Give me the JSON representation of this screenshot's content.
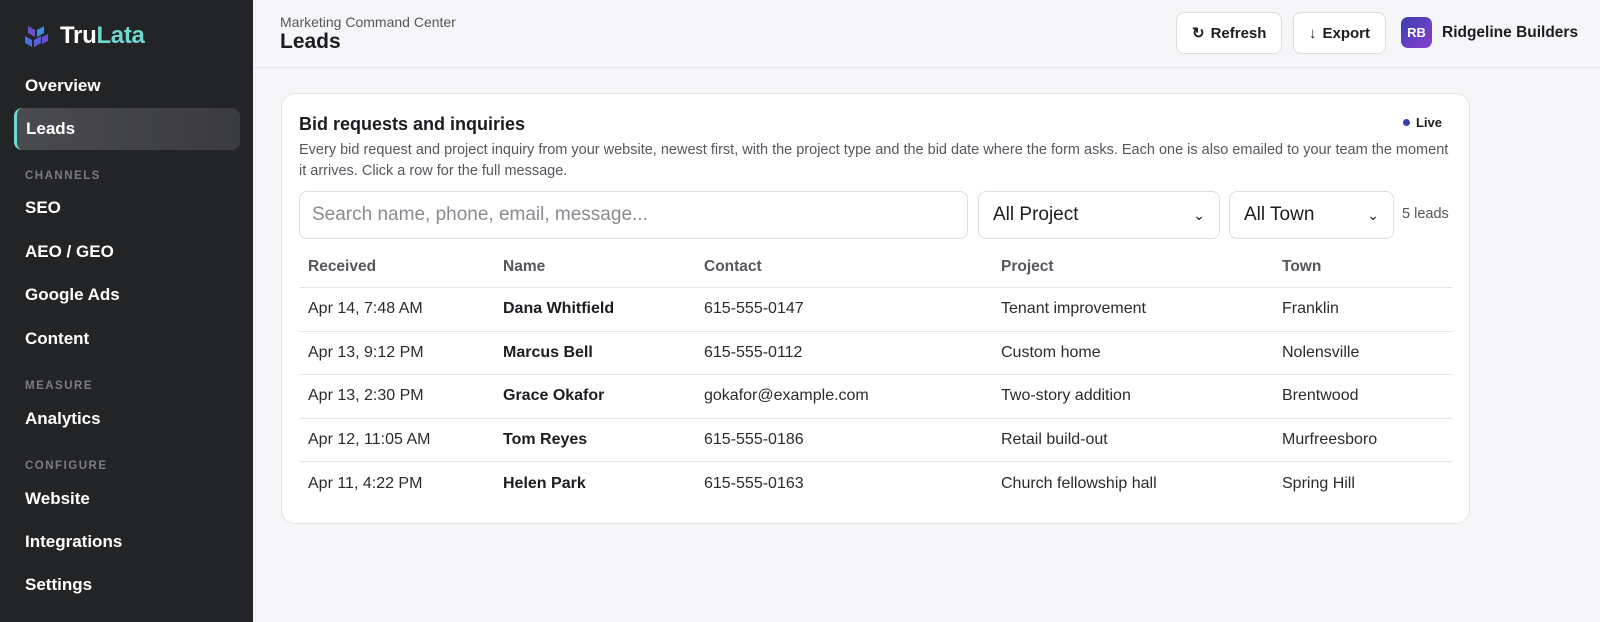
{
  "brand": {
    "name_part1": "Tru",
    "name_part2": "Lata",
    "logo_colors": [
      "#6a4fd0",
      "#3a8ee0"
    ]
  },
  "sidebar": {
    "items": [
      {
        "label": "Overview"
      },
      {
        "label": "Leads",
        "active": true
      },
      {
        "label": "SEO"
      },
      {
        "label": "AEO / GEO"
      },
      {
        "label": "Google Ads"
      },
      {
        "label": "Content"
      },
      {
        "label": "Analytics"
      },
      {
        "label": "Website"
      },
      {
        "label": "Integrations"
      },
      {
        "label": "Settings"
      }
    ],
    "sections": {
      "channels": "CHANNELS",
      "measure": "MEASURE",
      "configure": "CONFIGURE"
    }
  },
  "header": {
    "breadcrumb": "Marketing Command Center",
    "title": "Leads",
    "refresh_label": "Refresh",
    "refresh_icon": "refresh-icon",
    "export_label": "Export",
    "export_icon": "download-arrow-icon",
    "account": {
      "initials": "RB",
      "name": "Ridgeline Builders"
    }
  },
  "card": {
    "title": "Bid requests and inquiries",
    "live_label": "Live",
    "description": "Every bid request and project inquiry from your website, newest first, with the project type and the bid date where the form asks. Each one is also emailed to your team the moment it arrives. Click a row for the full message.",
    "search_placeholder": "Search name, phone, email, message...",
    "project_filter": "All Project",
    "town_filter": "All Town",
    "count": "5 leads"
  },
  "table": {
    "headers": [
      "Received",
      "Name",
      "Contact",
      "Project",
      "Town"
    ],
    "rows": [
      [
        "Apr 14, 7:48 AM",
        "Dana Whitfield",
        "615-555-0147",
        "Tenant improvement",
        "Franklin"
      ],
      [
        "Apr 13, 9:12 PM",
        "Marcus Bell",
        "615-555-0112",
        "Custom home",
        "Nolensville"
      ],
      [
        "Apr 13, 2:30 PM",
        "Grace Okafor",
        "gokafor@example.com",
        "Two-story addition",
        "Brentwood"
      ],
      [
        "Apr 12, 11:05 AM",
        "Tom Reyes",
        "615-555-0186",
        "Retail build-out",
        "Murfreesboro"
      ],
      [
        "Apr 11, 4:22 PM",
        "Helen Park",
        "615-555-0163",
        "Church fellowship hall",
        "Spring Hill"
      ]
    ]
  },
  "colors": {
    "sidebar_bg": "#232426",
    "accent": "#6fd8d0",
    "live_dot": "#3a3fb0"
  }
}
